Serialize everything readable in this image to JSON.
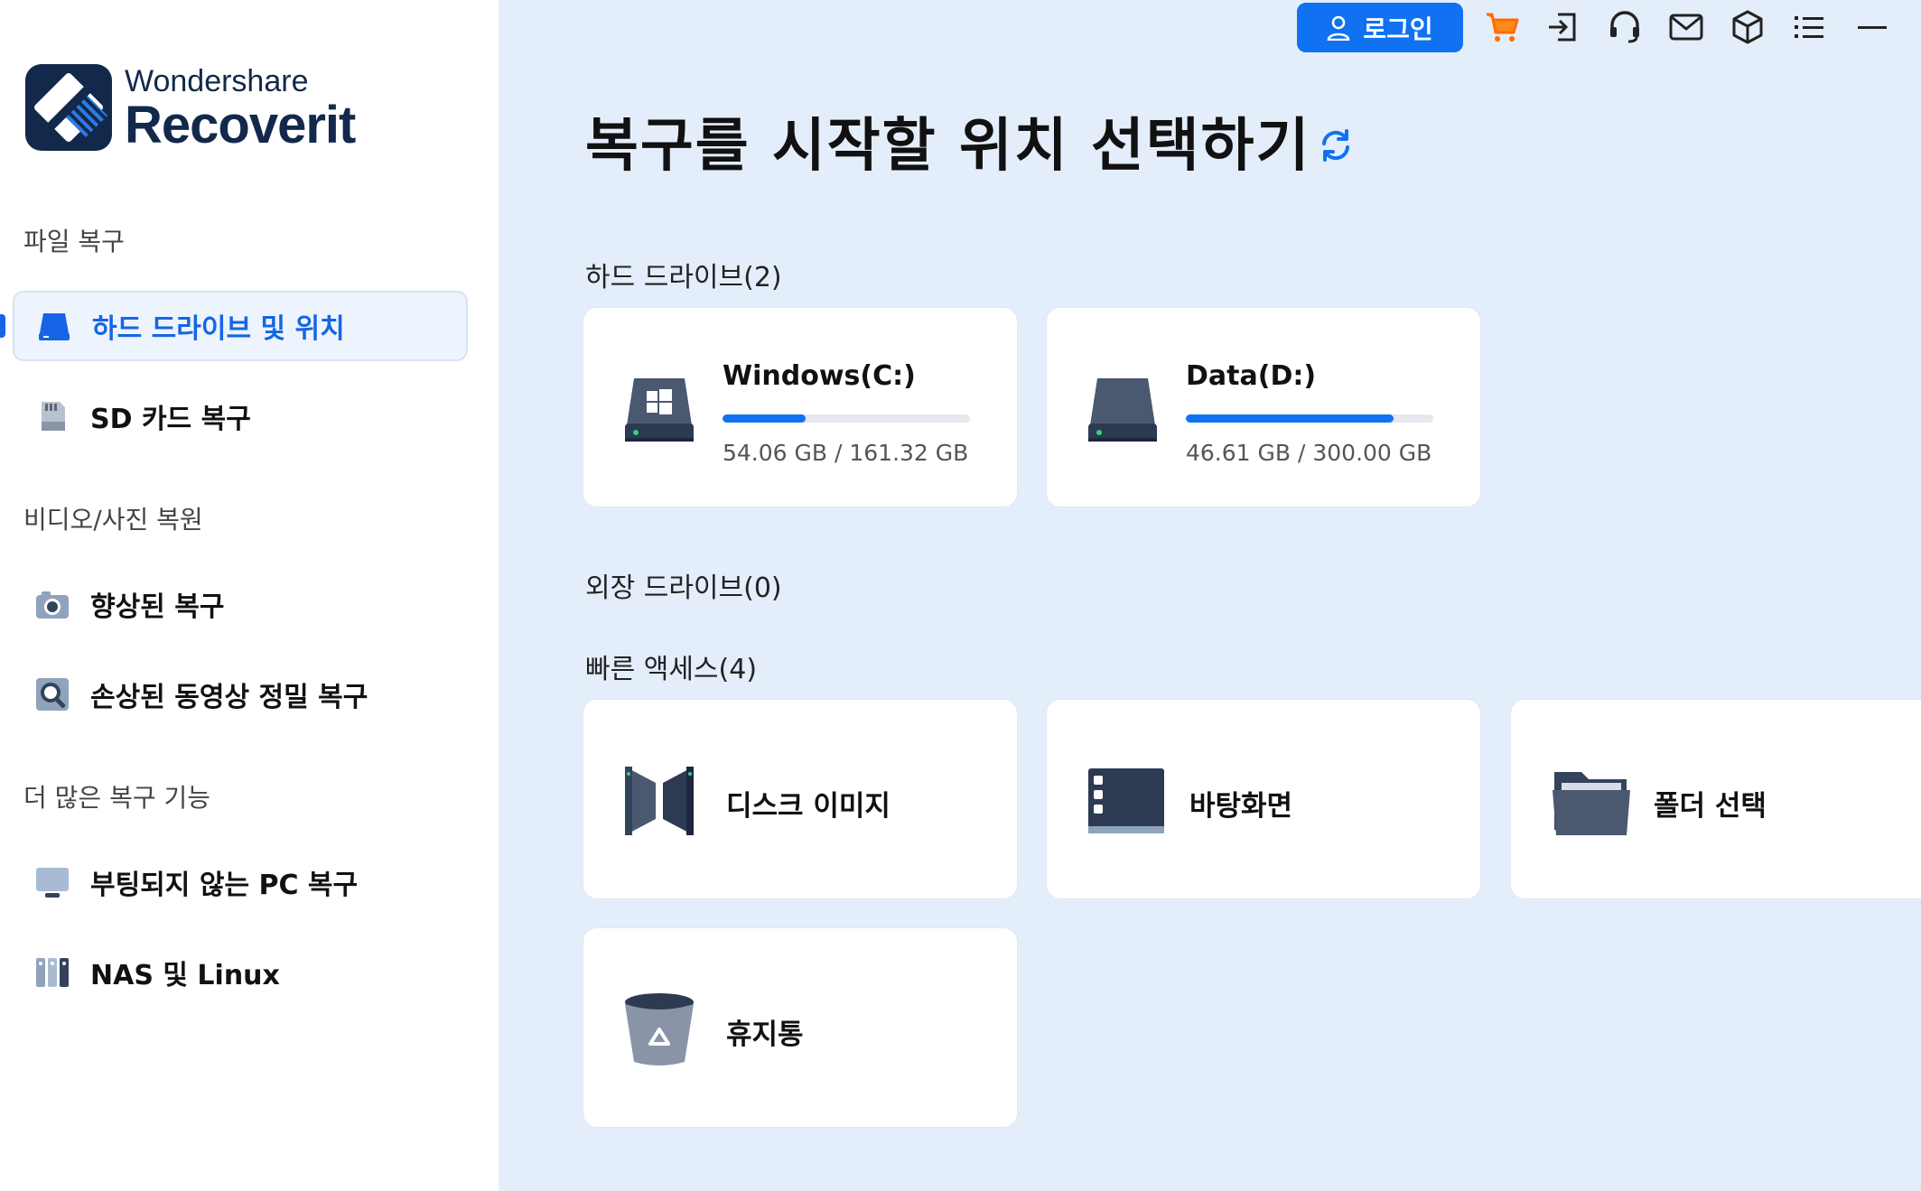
{
  "app": {
    "brand_sub": "Wondershare",
    "brand_main": "Recoverit"
  },
  "sidebar": {
    "sections": [
      {
        "title": "파일 복구",
        "items": [
          {
            "label": "하드 드라이브 및 위치",
            "icon": "hard-drive-icon",
            "active": true
          },
          {
            "label": "SD 카드 복구",
            "icon": "sd-card-icon",
            "active": false
          }
        ]
      },
      {
        "title": "비디오/사진 복원",
        "items": [
          {
            "label": "향상된 복구",
            "icon": "camera-icon",
            "active": false
          },
          {
            "label": "손상된 동영상 정밀 복구",
            "icon": "video-repair-icon",
            "active": false
          }
        ]
      },
      {
        "title": "더 많은 복구 기능",
        "items": [
          {
            "label": "부팅되지 않는 PC 복구",
            "icon": "monitor-icon",
            "active": false
          },
          {
            "label": "NAS 및 Linux",
            "icon": "nas-icon",
            "active": false
          }
        ]
      }
    ]
  },
  "topbar": {
    "login_label": "로그인",
    "icons": [
      "cart-icon",
      "sign-in-icon",
      "headset-icon",
      "mail-icon",
      "box-icon",
      "list-icon",
      "minimize-icon"
    ]
  },
  "main": {
    "title": "복구를 시작할 위치 선택하기",
    "hard_drives": {
      "title": "하드 드라이브(2)",
      "drives": [
        {
          "name": "Windows(C:)",
          "used": "54.06 GB",
          "total": "161.32 GB",
          "size_text": "54.06 GB / 161.32 GB",
          "fraction": 0.335
        },
        {
          "name": "Data(D:)",
          "used": "46.61 GB",
          "total": "300.00 GB",
          "size_text": "46.61 GB / 300.00 GB",
          "fraction": 0.84
        }
      ]
    },
    "external_drives": {
      "title": "외장 드라이브(0)"
    },
    "quick_access": {
      "title": "빠른 액세스(4)",
      "items": [
        {
          "label": "디스크 이미지",
          "icon": "disk-image-icon"
        },
        {
          "label": "바탕화면",
          "icon": "desktop-icon"
        },
        {
          "label": "폴더 선택",
          "icon": "folder-icon"
        },
        {
          "label": "휴지통",
          "icon": "recycle-bin-icon"
        }
      ]
    }
  },
  "colors": {
    "accent": "#1072f0",
    "sidebar_active_text": "#1565e6",
    "main_bg": "#e4eefb"
  }
}
